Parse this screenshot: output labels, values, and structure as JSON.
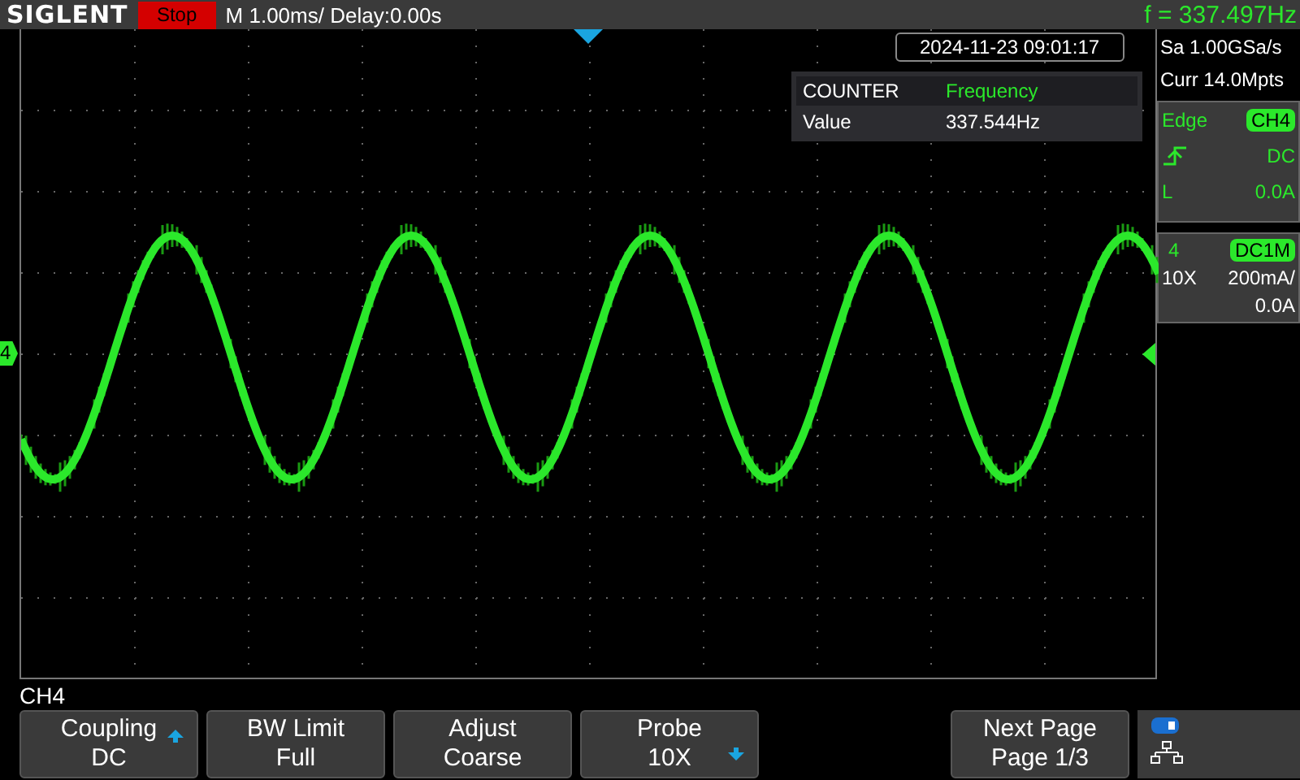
{
  "top_bar": {
    "brand": "SIGLENT",
    "run_state": {
      "label": "Stop",
      "kind": "stop"
    },
    "timebase": "M 1.00ms/ Delay:0.00s",
    "frequency": "f = 337.497Hz"
  },
  "datetime": "2024-11-23 09:01:17",
  "counter": {
    "title": "COUNTER",
    "mode": "Frequency",
    "label": "Value",
    "value": "337.544Hz"
  },
  "acquisition": [
    "Sa 1.00GSa/s",
    "Curr 14.0Mpts"
  ],
  "trigger": {
    "type": "Edge",
    "source": "CH4",
    "coupling": "DC",
    "level_label": "L",
    "level": "0.0A"
  },
  "channel": {
    "number": "4",
    "coupling": "DC1M",
    "probe": "10X",
    "scale": "200mA/",
    "offset": "0.0A"
  },
  "channel_marker": "4",
  "menu_title": "CH4",
  "softkeys": [
    {
      "title": "Coupling",
      "value": "DC",
      "kind": "up"
    },
    {
      "title": "BW Limit",
      "value": "Full",
      "kind": "plain"
    },
    {
      "title": "Adjust",
      "value": "Coarse",
      "kind": "plain"
    },
    {
      "title": "Probe",
      "value": "10X",
      "kind": "down"
    },
    {
      "title": "Next Page",
      "value": "Page 1/3",
      "kind": "plain"
    }
  ]
}
